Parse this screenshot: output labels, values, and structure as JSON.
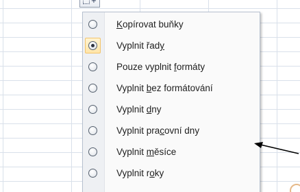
{
  "menu": {
    "items": [
      {
        "label": "Kopírovat buňky",
        "parts": [
          "",
          "K",
          "opírovat buňky"
        ],
        "checked": false
      },
      {
        "label": "Vyplnit řady",
        "parts": [
          "Vyplnit řad",
          "y",
          ""
        ],
        "checked": true
      },
      {
        "label": "Pouze vyplnit formáty",
        "parts": [
          "Pouze vyplnit ",
          "f",
          "ormáty"
        ],
        "checked": false
      },
      {
        "label": "Vyplnit bez formátování",
        "parts": [
          "Vyplnit ",
          "b",
          "ez formátování"
        ],
        "checked": false
      },
      {
        "label": "Vyplnit dny",
        "parts": [
          "Vyplnit ",
          "d",
          "ny"
        ],
        "checked": false
      },
      {
        "label": "Vyplnit pracovní dny",
        "parts": [
          "Vyplnit pra",
          "c",
          "ovní dny"
        ],
        "checked": false
      },
      {
        "label": "Vyplnit měsíce",
        "parts": [
          "Vyplnit ",
          "m",
          "ěsíce"
        ],
        "checked": false
      },
      {
        "label": "Vyplnit roky",
        "parts": [
          "Vyplnit r",
          "o",
          "ky"
        ],
        "checked": false
      }
    ]
  },
  "icons": {
    "autofill": "auto-fill-options-icon",
    "radio": "radio-button-icon",
    "arrow": "arrow-left-icon"
  },
  "colors": {
    "selection_highlight": "#ffe5a8",
    "grid_lines": "#d9e0ea",
    "annotation_arrow": "#000000"
  }
}
